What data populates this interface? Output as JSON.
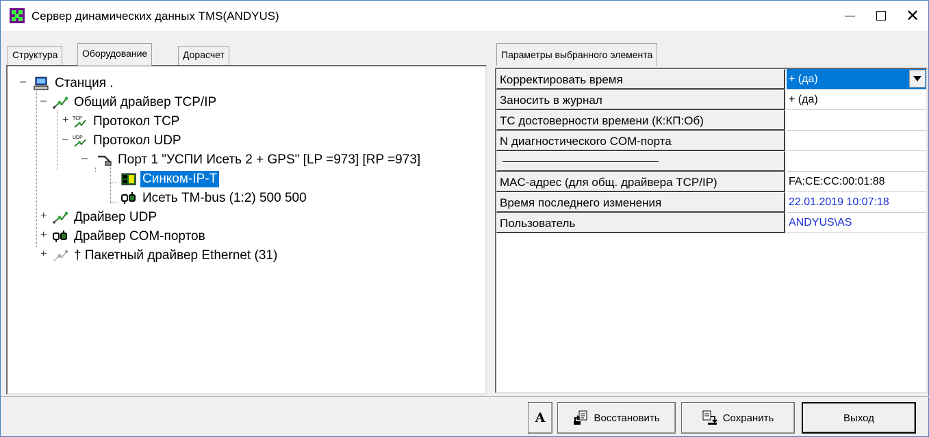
{
  "window": {
    "title": "Сервер динамических данных TMS(ANDYUS)",
    "controls": {
      "minimize": "—",
      "maximize": "☐",
      "close": "✕"
    }
  },
  "left_tabs": [
    {
      "label": "Структура",
      "active": false
    },
    {
      "label": "Оборудование",
      "active": true
    },
    {
      "label": "Дорасчет",
      "active": false
    }
  ],
  "tree": [
    {
      "label": "Станция .",
      "icon": "computer-icon",
      "expander": "–",
      "selected": false
    },
    {
      "label": "Общий драйвер TCP/IP",
      "icon": "network-driver-icon",
      "expander": "–",
      "selected": false
    },
    {
      "label": "Протокол TCP",
      "icon": "tcp-protocol-icon",
      "expander": "+",
      "selected": false
    },
    {
      "label": "Протокол UDP",
      "icon": "udp-protocol-icon",
      "expander": "–",
      "selected": false
    },
    {
      "label": "Порт  1 \"УСПИ Исеть 2 + GPS\" [LP =973] [RP =973]",
      "icon": "port-plug-icon",
      "expander": "–",
      "selected": false
    },
    {
      "label": "Синком-IP-T",
      "icon": "device-board-icon",
      "expander": "",
      "selected": true
    },
    {
      "label": "Исеть TM-bus  (1:2) 500 500",
      "icon": "bus-device-icon",
      "expander": "",
      "selected": false
    },
    {
      "label": "Драйвер UDP",
      "icon": "network-driver-icon",
      "expander": "+",
      "selected": false
    },
    {
      "label": "Драйвер COM-портов",
      "icon": "com-driver-icon",
      "expander": "+",
      "selected": false
    },
    {
      "label": "† Пакетный драйвер Ethernet  (31)",
      "icon": "ethernet-driver-icon",
      "expander": "+",
      "selected": false
    }
  ],
  "right_tab": {
    "label": "Параметры выбранного элемента"
  },
  "properties": [
    {
      "name": "Корректировать время",
      "value": "+ (да)",
      "selected": true,
      "dropdown": true,
      "link": false
    },
    {
      "name": "Заносить в журнал",
      "value": "+ (да)",
      "selected": false,
      "dropdown": false,
      "link": false
    },
    {
      "name": "ТС достоверности времени (К:КП:Об)",
      "value": "",
      "selected": false,
      "dropdown": false,
      "link": false
    },
    {
      "name": "N диагностического COM-порта",
      "value": "",
      "selected": false,
      "dropdown": false,
      "link": false
    },
    {
      "name": "",
      "value": "",
      "selected": false,
      "dropdown": false,
      "link": false,
      "separator": true
    },
    {
      "name": "MAC-адрес (для общ. драйвера TCP/IP)",
      "value": "FA:CE:CC:00:01:88",
      "selected": false,
      "dropdown": false,
      "link": false
    },
    {
      "name": "Время последнего изменения",
      "value": "22.01.2019 10:07:18",
      "selected": false,
      "dropdown": false,
      "link": true
    },
    {
      "name": "Пользователь",
      "value": "ANDYUS\\AS",
      "selected": false,
      "dropdown": false,
      "link": true
    }
  ],
  "buttons": {
    "font": "A",
    "restore": "Восстановить",
    "save": "Сохранить",
    "exit": "Выход"
  },
  "colors": {
    "selection": "#0078d7",
    "link": "#1a2fd9",
    "app_icon_bg": "#6e0a8c",
    "app_icon_fg": "#3bff3b"
  }
}
